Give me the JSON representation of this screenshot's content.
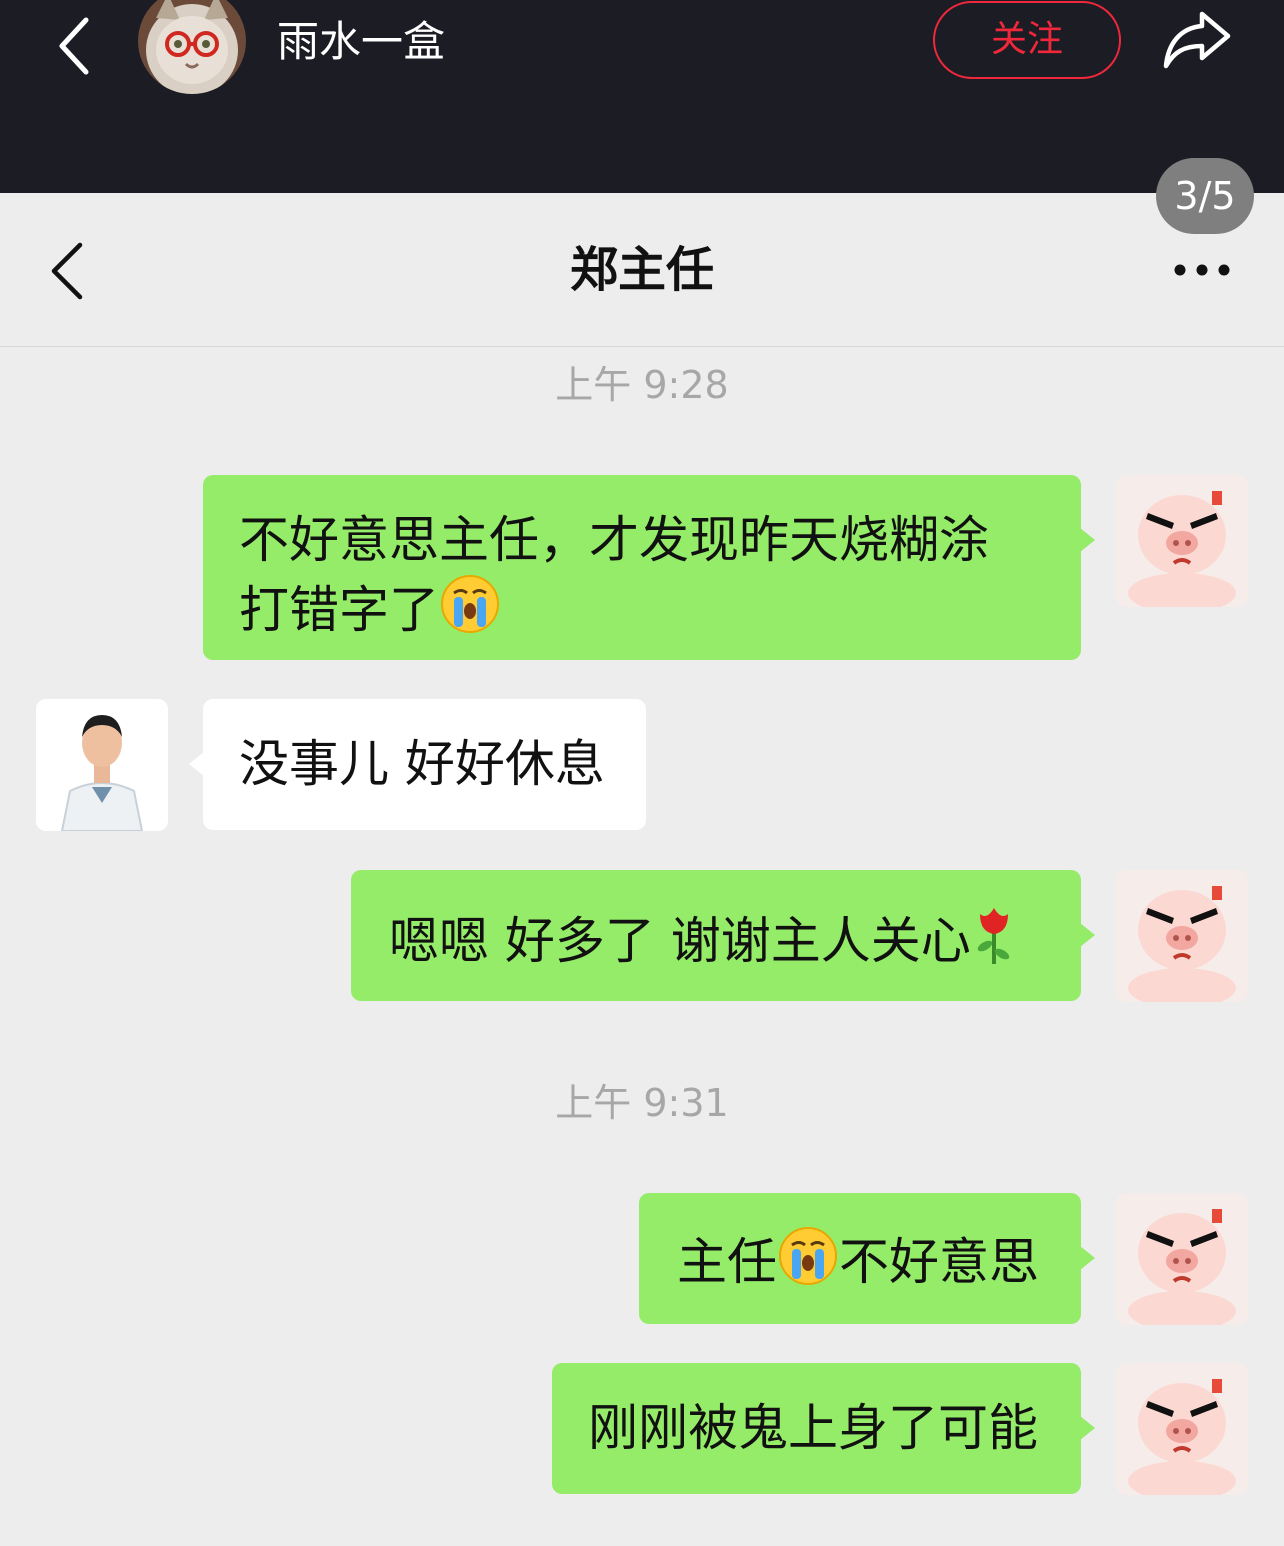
{
  "app_header": {
    "username": "雨水一盒",
    "follow_label": "关注",
    "page_indicator": "3/5",
    "icons": [
      "back-icon",
      "user-avatar",
      "share-icon"
    ],
    "colors": {
      "background": "#1c1c24",
      "follow": "#f1283c"
    }
  },
  "chat": {
    "title": "郑主任",
    "icons": [
      "chevron-left-icon",
      "more-icon"
    ],
    "colors": {
      "sent_bubble": "#95ec69",
      "received_bubble": "#ffffff",
      "background": "#ededed"
    },
    "timestamps": [
      "上午 9:28",
      "上午 9:31"
    ],
    "messages": [
      {
        "side": "sent",
        "parts": [
          "不好意思主任，才发现昨天烧糊涂",
          "打错字了"
        ],
        "emoji": "crying-face"
      },
      {
        "side": "received",
        "text": "没事儿 好好休息"
      },
      {
        "side": "sent",
        "text": "嗯嗯 好多了 谢谢主人关心",
        "emoji": "rose"
      },
      {
        "side": "sent",
        "text_before": "主任",
        "text_after": "不好意思",
        "emoji": "crying-face"
      },
      {
        "side": "sent",
        "text": "刚刚被鬼上身了可能"
      }
    ]
  }
}
